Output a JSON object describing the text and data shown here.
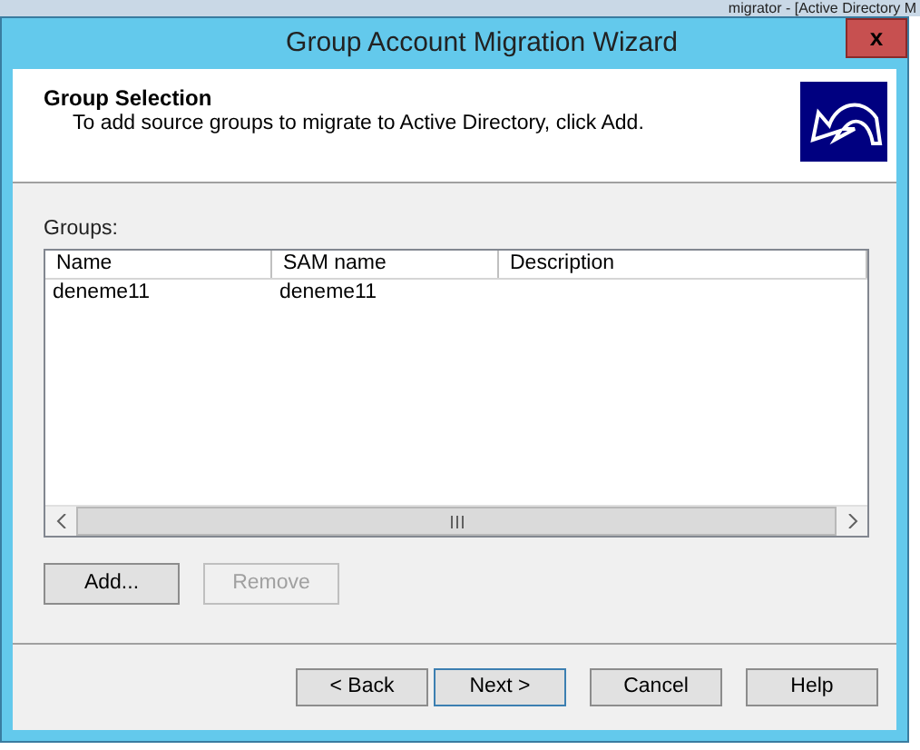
{
  "background_window": {
    "title": "migrator - [Active Directory M"
  },
  "window": {
    "title": "Group Account Migration Wizard",
    "close": "x"
  },
  "header": {
    "title": "Group Selection",
    "subtitle": "To add source groups to migrate to Active Directory, click Add."
  },
  "groups": {
    "label": "Groups:",
    "columns": [
      "Name",
      "SAM name",
      "Description"
    ],
    "rows": [
      {
        "cells": [
          "deneme11",
          "deneme11",
          ""
        ],
        "selected": false
      }
    ]
  },
  "list_buttons": [
    {
      "label": "Add...",
      "disabled": false
    },
    {
      "label": "Remove",
      "disabled": true
    }
  ],
  "nav_buttons": [
    {
      "label": "< Back",
      "focused": false
    },
    {
      "label": "Next >",
      "focused": true
    },
    {
      "label": "Cancel",
      "focused": false
    },
    {
      "label": "Help",
      "focused": false
    }
  ]
}
